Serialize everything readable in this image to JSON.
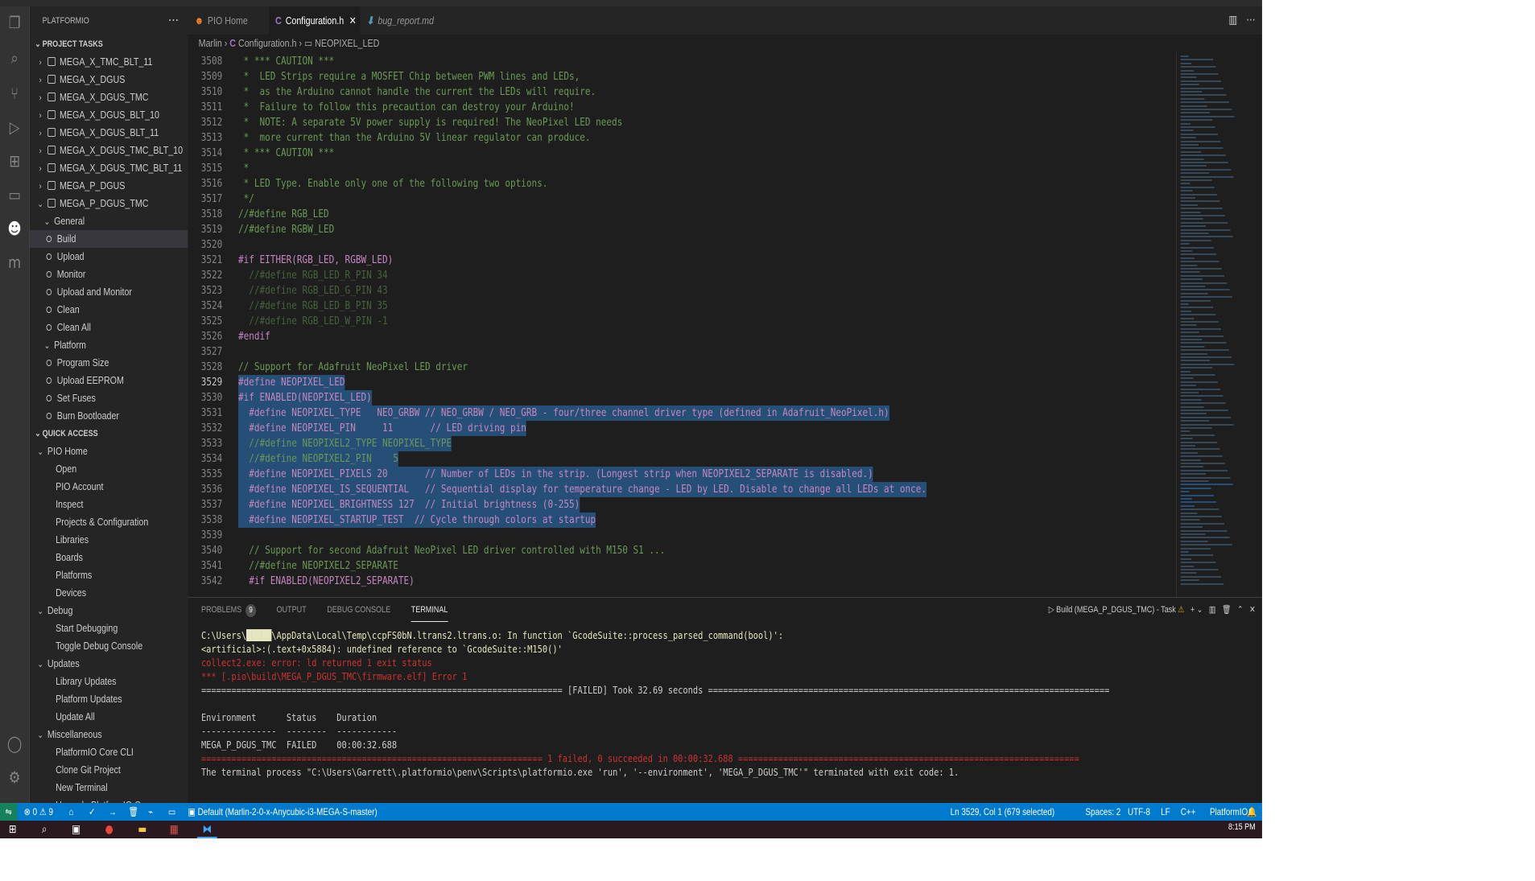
{
  "sidebar": {
    "title": "PLATFORMIO",
    "project_tasks": "PROJECT TASKS",
    "envs": [
      "MEGA_X_TMC_BLT_11",
      "MEGA_X_DGUS",
      "MEGA_X_DGUS_TMC",
      "MEGA_X_DGUS_BLT_10",
      "MEGA_X_DGUS_BLT_11",
      "MEGA_X_DGUS_TMC_BLT_10",
      "MEGA_X_DGUS_TMC_BLT_11",
      "MEGA_P_DGUS"
    ],
    "open_env": "MEGA_P_DGUS_TMC",
    "general": "General",
    "general_items": [
      "Build",
      "Upload",
      "Monitor",
      "Upload and Monitor",
      "Clean",
      "Clean All"
    ],
    "platform": "Platform",
    "platform_items": [
      "Program Size",
      "Upload EEPROM",
      "Set Fuses",
      "Burn Bootloader"
    ],
    "quick_access": "QUICK ACCESS",
    "pio_home": "PIO Home",
    "pio_home_items": [
      "Open",
      "PIO Account",
      "Inspect",
      "Projects & Configuration",
      "Libraries",
      "Boards",
      "Platforms",
      "Devices"
    ],
    "debug": "Debug",
    "debug_items": [
      "Start Debugging",
      "Toggle Debug Console"
    ],
    "updates": "Updates",
    "updates_items": [
      "Library Updates",
      "Platform Updates",
      "Update All"
    ],
    "misc": "Miscellaneous",
    "misc_items": [
      "PlatformIO Core CLI",
      "Clone Git Project",
      "New Terminal",
      "Upgrade PlatformIO Core"
    ]
  },
  "tabs": [
    {
      "label": "PIO Home",
      "icon": "platformio-icon"
    },
    {
      "label": "Configuration.h",
      "icon": "c-file-icon"
    },
    {
      "label": "bug_report.md",
      "icon": "markdown-icon"
    }
  ],
  "breadcrumb": {
    "root": "Marlin",
    "file": "Configuration.h",
    "symbol": "NEOPIXEL_LED"
  },
  "code": [
    {
      "n": "3508",
      "t": " * *** CAUTION ***",
      "c": "cmt"
    },
    {
      "n": "3509",
      "t": " *  LED Strips require a MOSFET Chip between PWM lines and LEDs,",
      "c": "cmt"
    },
    {
      "n": "3510",
      "t": " *  as the Arduino cannot handle the current the LEDs will require.",
      "c": "cmt"
    },
    {
      "n": "3511",
      "t": " *  Failure to follow this precaution can destroy your Arduino!",
      "c": "cmt"
    },
    {
      "n": "3512",
      "t": " *  NOTE: A separate 5V power supply is required! The NeoPixel LED needs",
      "c": "cmt"
    },
    {
      "n": "3513",
      "t": " *  more current than the Arduino 5V linear regulator can produce.",
      "c": "cmt"
    },
    {
      "n": "3514",
      "t": " * *** CAUTION ***",
      "c": "cmt"
    },
    {
      "n": "3515",
      "t": " *",
      "c": "cmt"
    },
    {
      "n": "3516",
      "t": " * LED Type. Enable only one of the following two options.",
      "c": "cmt"
    },
    {
      "n": "3517",
      "t": " */",
      "c": "cmt"
    },
    {
      "n": "3518",
      "t": "//#define RGB_LED",
      "c": "cmt"
    },
    {
      "n": "3519",
      "t": "//#define RGBW_LED",
      "c": "cmt"
    },
    {
      "n": "3520",
      "t": "",
      "c": "tx"
    },
    {
      "n": "3521",
      "t": "#if EITHER(RGB_LED, RGBW_LED)",
      "c": "kw"
    },
    {
      "n": "3522",
      "t": "  //#define RGB_LED_R_PIN 34",
      "c": "cmt dim"
    },
    {
      "n": "3523",
      "t": "  //#define RGB_LED_G_PIN 43",
      "c": "cmt dim"
    },
    {
      "n": "3524",
      "t": "  //#define RGB_LED_B_PIN 35",
      "c": "cmt dim"
    },
    {
      "n": "3525",
      "t": "  //#define RGB_LED_W_PIN -1",
      "c": "cmt dim"
    },
    {
      "n": "3526",
      "t": "#endif",
      "c": "kw"
    },
    {
      "n": "3527",
      "t": "",
      "c": "tx"
    },
    {
      "n": "3528",
      "t": "// Support for Adafruit NeoPixel LED driver",
      "c": "cmt"
    },
    {
      "n": "3529",
      "t": "#define NEOPIXEL_LED",
      "c": "kw",
      "sel": true
    },
    {
      "n": "3530",
      "t": "#if ENABLED(NEOPIXEL_LED)",
      "c": "kw",
      "sel": true
    },
    {
      "n": "3531",
      "t": "  #define NEOPIXEL_TYPE   NEO_GRBW // NEO_GRBW / NEO_GRB - four/three channel driver type (defined in Adafruit_NeoPixel.h)",
      "c": "kw",
      "sel": true
    },
    {
      "n": "3532",
      "t": "  #define NEOPIXEL_PIN     11       // LED driving pin",
      "c": "kw",
      "sel": true
    },
    {
      "n": "3533",
      "t": "  //#define NEOPIXEL2_TYPE NEOPIXEL_TYPE",
      "c": "cmt",
      "sel": true
    },
    {
      "n": "3534",
      "t": "  //#define NEOPIXEL2_PIN    5",
      "c": "cmt",
      "sel": true
    },
    {
      "n": "3535",
      "t": "  #define NEOPIXEL_PIXELS 20       // Number of LEDs in the strip. (Longest strip when NEOPIXEL2_SEPARATE is disabled.)",
      "c": "kw",
      "sel": true
    },
    {
      "n": "3536",
      "t": "  #define NEOPIXEL_IS_SEQUENTIAL   // Sequential display for temperature change - LED by LED. Disable to change all LEDs at once.",
      "c": "kw",
      "sel": true
    },
    {
      "n": "3537",
      "t": "  #define NEOPIXEL_BRIGHTNESS 127  // Initial brightness (0-255)",
      "c": "kw",
      "sel": true
    },
    {
      "n": "3538",
      "t": "  #define NEOPIXEL_STARTUP_TEST  // Cycle through colors at startup",
      "c": "kw",
      "sel": true
    },
    {
      "n": "3539",
      "t": "",
      "c": "tx"
    },
    {
      "n": "3540",
      "t": "  // Support for second Adafruit NeoPixel LED driver controlled with M150 S1 ...",
      "c": "cmt"
    },
    {
      "n": "3541",
      "t": "  //#define NEOPIXEL2_SEPARATE",
      "c": "cmt"
    },
    {
      "n": "3542",
      "t": "  #if ENABLED(NEOPIXEL2_SEPARATE)",
      "c": "kw"
    }
  ],
  "panel": {
    "tabs": [
      "PROBLEMS",
      "OUTPUT",
      "DEBUG CONSOLE",
      "TERMINAL"
    ],
    "problems_count": "9",
    "task": "Build (MEGA_P_DGUS_TMC) - Task"
  },
  "terminal": [
    {
      "t": "C:\\Users\\█████\\AppData\\Local\\Temp\\ccpFS0bN.ltrans2.ltrans.o: In function `GcodeSuite::process_parsed_command(bool)':",
      "col": "#e5e5c0"
    },
    {
      "t": "<artificial>:(.text+0x5884): undefined reference to `GcodeSuite::M150()'",
      "col": "#e5e5c0"
    },
    {
      "t": "collect2.exe: error: ld returned 1 exit status",
      "col": "#cd3131"
    },
    {
      "t": "*** [.pio\\build\\MEGA_P_DGUS_TMC\\firmware.elf] Error 1",
      "col": "#cd3131"
    },
    {
      "t": "======================================================================== [FAILED] Took 32.69 seconds ================================================================================",
      "col": "#cccccc"
    },
    {
      "t": "",
      "col": "#ccc"
    },
    {
      "t": "Environment      Status    Duration",
      "col": "#cccccc"
    },
    {
      "t": "---------------  --------  ------------",
      "col": "#cccccc"
    },
    {
      "t": "MEGA_P_DGUS_TMC  FAILED    00:00:32.688",
      "col": "#cccccc"
    },
    {
      "t": "==================================================================== 1 failed, 0 succeeded in 00:00:32.688 ====================================================================",
      "col": "#cd3131"
    },
    {
      "t": "The terminal process \"C:\\Users\\Garrett\\.platformio\\penv\\Scripts\\platformio.exe 'run', '--environment', 'MEGA_P_DGUS_TMC'\" terminated with exit code: 1.",
      "col": "#cccccc"
    }
  ],
  "status": {
    "errors": "0",
    "warnings": "9",
    "env": "Default (Marlin-2-0-x-Anycubic-i3-MEGA-S-master)",
    "position": "Ln 3529, Col 1 (679 selected)",
    "spaces": "Spaces: 2",
    "encoding": "UTF-8",
    "eol": "LF",
    "language": "C++",
    "platformio": "PlatformIO"
  },
  "clock": {
    "time": "8:15 PM"
  },
  "colors": {
    "accent": "#007acc",
    "editor_bg": "#1e1e1e",
    "selection": "#264f78"
  }
}
